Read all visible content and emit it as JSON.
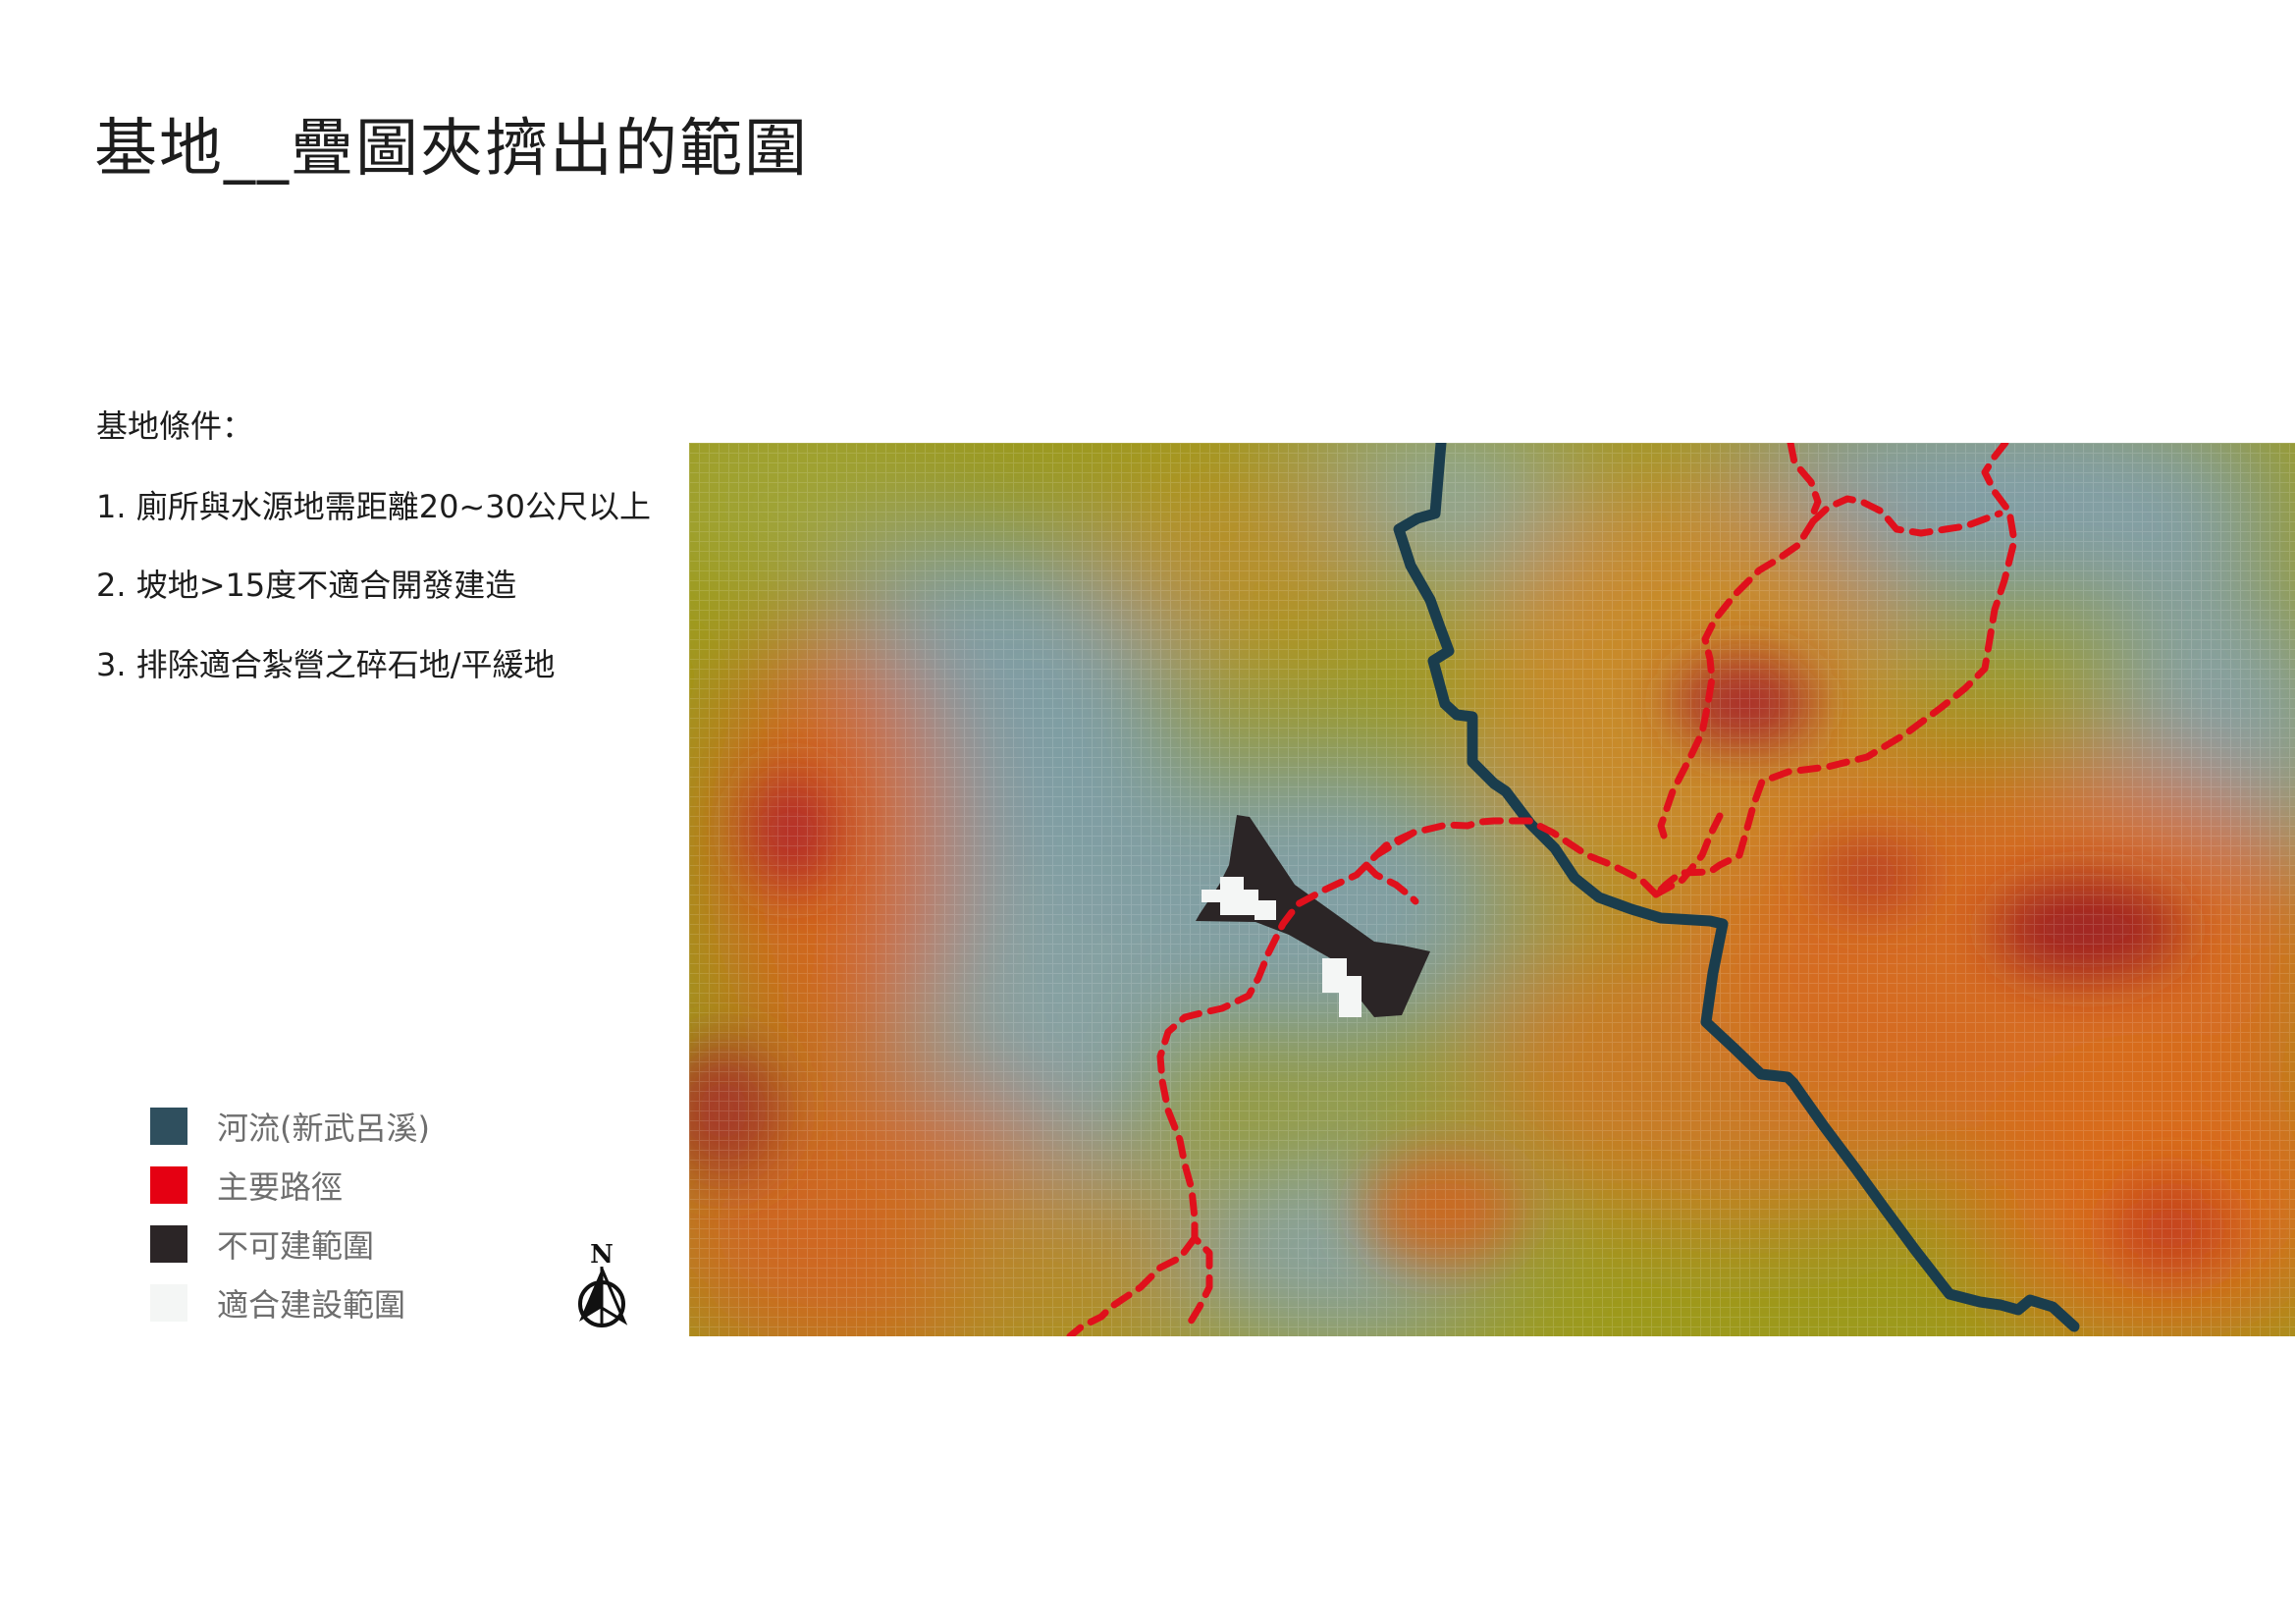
{
  "title": "基地__疊圖夾擠出的範圍",
  "conditions": {
    "heading": "基地條件：",
    "items": [
      "1. 廁所與水源地需距離20~30公尺以上",
      "2. 坡地>15度不適合開發建造",
      "3. 排除適合紮營之碎石地/平緩地"
    ]
  },
  "legend": [
    {
      "label": "河流(新武呂溪)",
      "color": "#2f4f5e"
    },
    {
      "label": "主要路徑",
      "color": "#e50012"
    },
    {
      "label": "不可建範圍",
      "color": "#2b2526"
    },
    {
      "label": "適合建設範圍",
      "color": "#f4f6f5"
    }
  ],
  "north_arrow": {
    "label": "N",
    "icon": "north-arrow-icon"
  },
  "map": {
    "basemap": "slope heatmap (blue-green low, yellow, orange, red high)",
    "colors": {
      "river": "#1a3d4d",
      "path": "#e0101c",
      "unbuildable": "#2b2526",
      "buildable": "#f4f6f5",
      "low": "#7d9a9e",
      "mid": "#9a9a18",
      "high": "#e0681e",
      "peak": "#b3242a"
    }
  }
}
